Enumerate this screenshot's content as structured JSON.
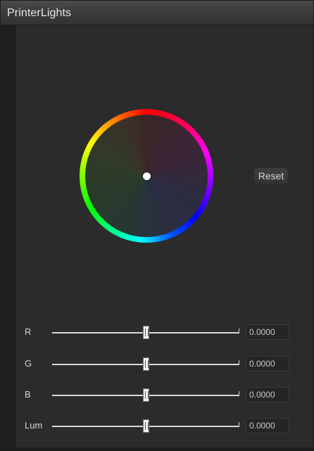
{
  "window": {
    "title": "PrinterLights"
  },
  "color_wheel": {
    "icon": "color-wheel"
  },
  "reset_button": {
    "label": "Reset"
  },
  "sliders": [
    {
      "label": "R",
      "value": "0.0000"
    },
    {
      "label": "G",
      "value": "0.0000"
    },
    {
      "label": "B",
      "value": "0.0000"
    },
    {
      "label": "Lum",
      "value": "0.0000"
    }
  ]
}
